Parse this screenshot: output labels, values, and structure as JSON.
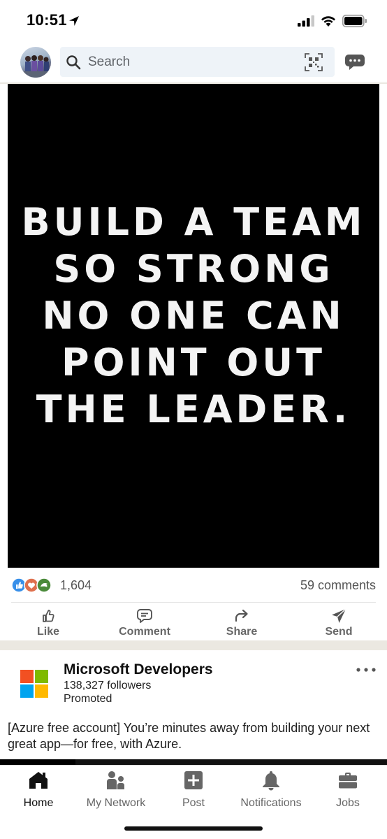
{
  "status": {
    "time": "10:51"
  },
  "header": {
    "search_placeholder": "Search"
  },
  "post": {
    "quote_lines": [
      "BUILD A TEAM",
      "SO STRONG",
      "NO ONE CAN",
      "POINT OUT",
      "THE LEADER."
    ],
    "reaction_count": "1,604",
    "comments": "59 comments",
    "actions": {
      "like": "Like",
      "comment": "Comment",
      "share": "Share",
      "send": "Send"
    }
  },
  "ad": {
    "company": "Microsoft Developers",
    "followers": "138,327 followers",
    "promoted": "Promoted",
    "text": "[Azure free account] You’re minutes away from building your next great app—for free, with Azure.",
    "logo_colors": [
      "#f25022",
      "#7fba00",
      "#00a4ef",
      "#ffb900"
    ]
  },
  "nav": {
    "home": "Home",
    "network": "My Network",
    "post": "Post",
    "notifications": "Notifications",
    "jobs": "Jobs"
  },
  "colors": {
    "linkedin_blue": "#0a66c2",
    "icon_gray": "#666666",
    "feed_bg": "#ebe8e1"
  }
}
